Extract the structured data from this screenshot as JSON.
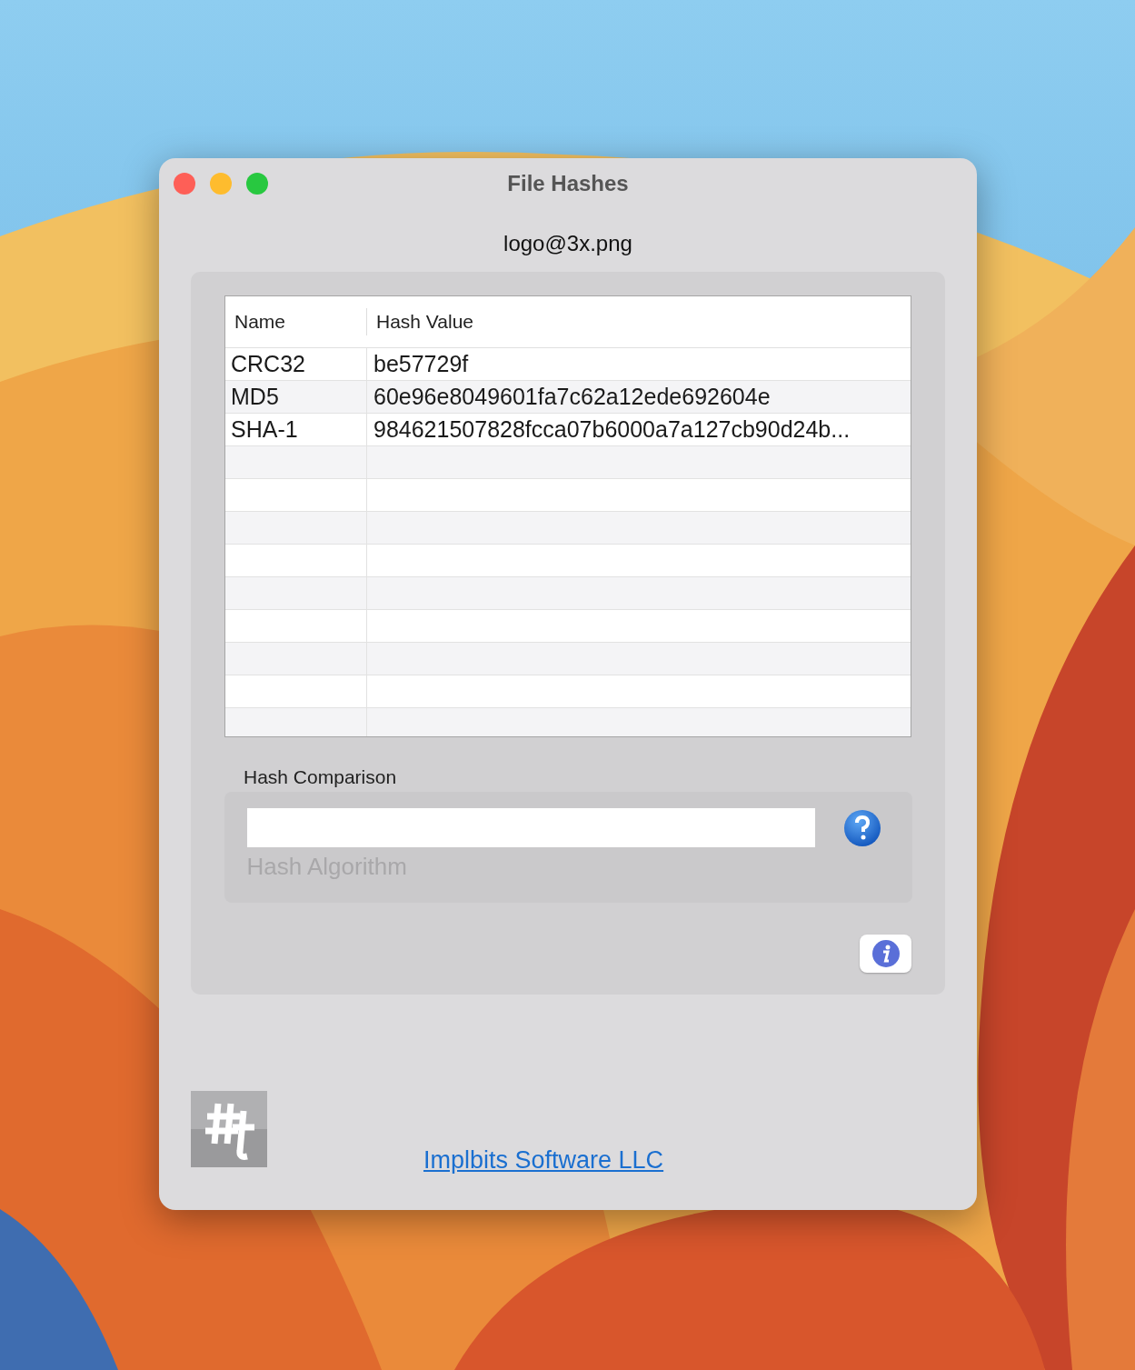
{
  "window": {
    "title": "File Hashes"
  },
  "file_name": "logo@3x.png",
  "table": {
    "columns": [
      "Name",
      "Hash Value"
    ],
    "rows": [
      {
        "name": "CRC32",
        "hash": "be57729f"
      },
      {
        "name": "MD5",
        "hash": "60e96e8049601fa7c62a12ede692604e"
      },
      {
        "name": "SHA-1",
        "hash": "984621507828fcca07b6000a7a127cb90d24b..."
      }
    ]
  },
  "comparison": {
    "label": "Hash Comparison",
    "algorithm": {
      "label": "Hash Algorithm",
      "disabled": true
    }
  },
  "link": "Implbits Software LLC"
}
